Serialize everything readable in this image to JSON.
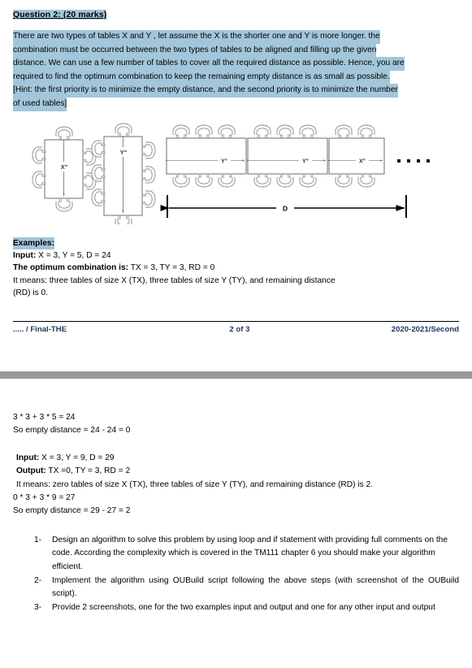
{
  "question": {
    "title": "Question 2: (20 marks)",
    "paragraph_lines": [
      "There are two types of tables X and Y , let assume the X is the shorter one and Y is more longer. the",
      "combination must be occurred between the two types of tables to be aligned and filling up the given",
      "distance. We can use a few number of tables to cover all the required distance as possible. Hence, you are",
      "required to find the optimum combination to keep the remaining empty distance is as small as possible.",
      " [Hint: the first priority is to minimize the empty distance, and the second priority is to minimize the number",
      "of used tables]"
    ]
  },
  "diagram": {
    "label_x": "X\"",
    "label_y": "Y\"",
    "row_labels": [
      "Y\"",
      "Y\"",
      "X\""
    ],
    "distance_label": "D",
    "ellipsis": "▪ ▪ ▪ ▪"
  },
  "examples": {
    "heading": "Examples:",
    "example1": {
      "input_label": "Input:",
      "input_value": " X = 3, Y = 5, D = 24",
      "optimum_label": "The optimum combination is:",
      "optimum_value": " TX = 3, TY = 3, RD = 0",
      "meaning_line1": "It means: three tables of size X (TX), three tables of size Y (TY), and remaining distance",
      "meaning_line2": " (RD) is 0.",
      "calc_line1": "3 * 3 + 3 * 5 = 24",
      "calc_line2": "So empty distance = 24 - 24 = 0"
    },
    "example2": {
      "input_label": "Input:",
      "input_value": " X = 3, Y = 9, D = 29",
      "output_label": "Output:",
      "output_value": " TX =0, TY = 3, RD = 2",
      "meaning_line": " It means: zero tables of size X (TX), three tables of size Y (TY), and remaining distance (RD) is 2.",
      "calc_line1": "0 * 3 + 3 * 9 = 27",
      "calc_line2": "So empty distance = 29 - 27 = 2"
    }
  },
  "footer": {
    "left": "..... / Final-THE",
    "center": "2 of 3",
    "right": "2020-2021/Second"
  },
  "tasks": [
    {
      "num": "1-",
      "text": "Design an algorithm to solve this problem by using loop and if statement with providing full comments on the code.  According the complexity which is covered in the TM111 chapter 6 you should make your algorithm efficient."
    },
    {
      "num": "2-",
      "text": "Implement the algorithm using OUBuild script following the above steps (with screenshot of the OUBuild script)."
    },
    {
      "num": "3-",
      "text": " Provide 2 screenshots, one for the two examples input and output and one for any other input and output"
    }
  ],
  "colors": {
    "highlight": "#a3c6da",
    "footer_text": "#1f3864",
    "page_divider": "#9a9a9a"
  }
}
